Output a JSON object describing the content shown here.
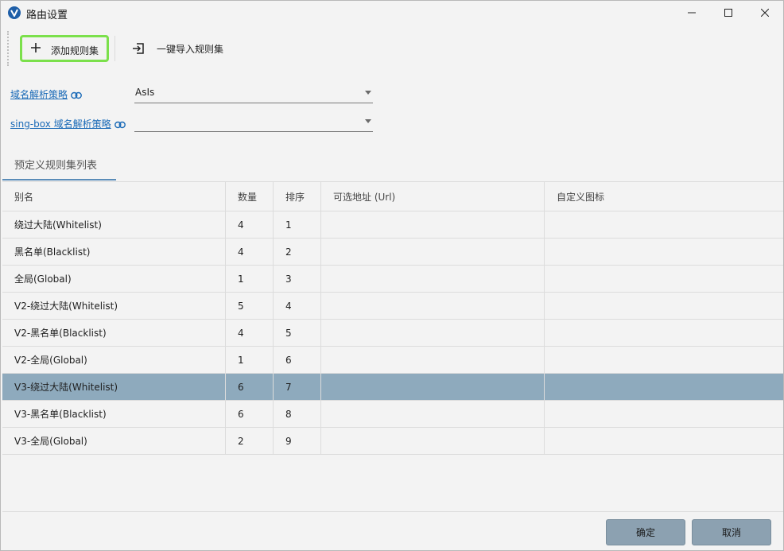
{
  "window": {
    "title": "路由设置",
    "app_icon": "v2rayn-logo",
    "controls": [
      "minimize-icon",
      "maximize-icon",
      "close-icon"
    ]
  },
  "toolbar": {
    "add_label": "添加规则集",
    "import_label": "一键导入规则集"
  },
  "form": {
    "domain_strategy_label": "域名解析策略",
    "domain_strategy_value": "AsIs",
    "singbox_strategy_label": "sing-box 域名解析策略",
    "singbox_strategy_value": ""
  },
  "tabs": [
    {
      "label": "预定义规则集列表",
      "active": true
    }
  ],
  "table": {
    "columns": [
      "别名",
      "数量",
      "排序",
      "可选地址 (Url)",
      "自定义图标"
    ],
    "rows": [
      {
        "alias": "绕过大陆(Whitelist)",
        "count": "4",
        "order": "1",
        "url": "",
        "icon": ""
      },
      {
        "alias": "黑名单(Blacklist)",
        "count": "4",
        "order": "2",
        "url": "",
        "icon": ""
      },
      {
        "alias": "全局(Global)",
        "count": "1",
        "order": "3",
        "url": "",
        "icon": ""
      },
      {
        "alias": "V2-绕过大陆(Whitelist)",
        "count": "5",
        "order": "4",
        "url": "",
        "icon": ""
      },
      {
        "alias": "V2-黑名单(Blacklist)",
        "count": "4",
        "order": "5",
        "url": "",
        "icon": ""
      },
      {
        "alias": "V2-全局(Global)",
        "count": "1",
        "order": "6",
        "url": "",
        "icon": ""
      },
      {
        "alias": "V3-绕过大陆(Whitelist)",
        "count": "6",
        "order": "7",
        "url": "",
        "icon": ""
      },
      {
        "alias": "V3-黑名单(Blacklist)",
        "count": "6",
        "order": "8",
        "url": "",
        "icon": ""
      },
      {
        "alias": "V3-全局(Global)",
        "count": "2",
        "order": "9",
        "url": "",
        "icon": ""
      }
    ],
    "selected_row_index": 6
  },
  "footer": {
    "ok_label": "确定",
    "cancel_label": "取消"
  },
  "colors": {
    "accent_link": "#1a6ab7",
    "selected_row": "#8eaabd",
    "button_bg": "#8ca1b1",
    "highlight_border": "#7be04b"
  }
}
